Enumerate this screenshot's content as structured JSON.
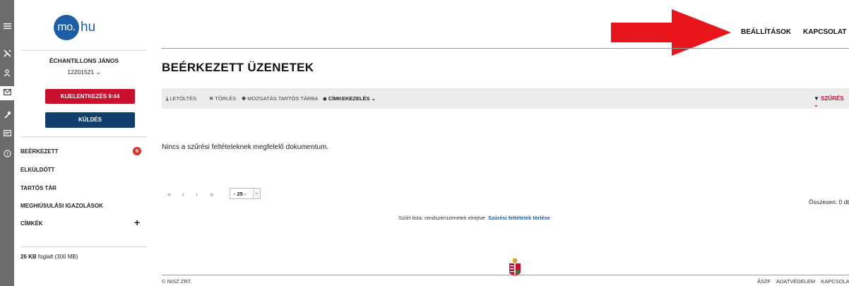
{
  "rail": {
    "icons": [
      "menu-icon",
      "tools-icon",
      "user-icon",
      "mail-icon",
      "wrench-icon",
      "card-icon",
      "help-icon"
    ]
  },
  "brand": {
    "logo_left": "mo.",
    "logo_right": "hu",
    "color": "#1d5fa6"
  },
  "user": {
    "name": "ÉCHANTILLONS JÁNOS",
    "id": "12201521 ⌄"
  },
  "buttons": {
    "logout": "KIJELENTKEZÉS 9:44",
    "send": "KÜLDÉS"
  },
  "nav": {
    "items": [
      {
        "label": "BEÉRKEZETT",
        "badge": "6"
      },
      {
        "label": "ELKÜLDÖTT"
      },
      {
        "label": "TARTÓS TÁR"
      },
      {
        "label": "MEGHIÚSULÁSI IGAZOLÁSOK"
      },
      {
        "label": "CÍMKÉK",
        "action": "+"
      }
    ]
  },
  "storage": {
    "used": "26 KB",
    "rest": " foglalt (300 MB)"
  },
  "topnav": {
    "settings": "BEÁLLÍTÁSOK",
    "contact": "KAPCSOLAT"
  },
  "main": {
    "title": "BEÉRKEZETT ÜZENETEK",
    "toolbar": {
      "download": "LETÖLTÉS",
      "delete": "TÖRLÉS",
      "move": "MOZGATÁS TARTÓS TÁRBA",
      "labels": "CÍMKEKEZELÉS ⌄",
      "filter": "SZŰRÉS ⌄"
    },
    "empty_message": "Nincs a szűrési feltételeknek megfelelő dokumentum.",
    "pager": {
      "first": "«",
      "prev": "‹",
      "next": "›",
      "last": "»",
      "page_size": "- 25 -",
      "total": "Összesen: 0 db"
    },
    "filtered_note": "Szűrt lista: rendszerüzenetek elrejtve",
    "clear_filters": "Szűrési feltételek törlése"
  },
  "footer": {
    "copyright": "© NISZ ZRT.",
    "links": [
      "ÁSZF",
      "ADATVÉDELEM",
      "KAPCSOLAT"
    ]
  },
  "colors": {
    "accent_red": "#c8102e",
    "navy": "#123e6b",
    "rail": "#6b6b6b",
    "annotation_arrow": "#e8161b"
  }
}
